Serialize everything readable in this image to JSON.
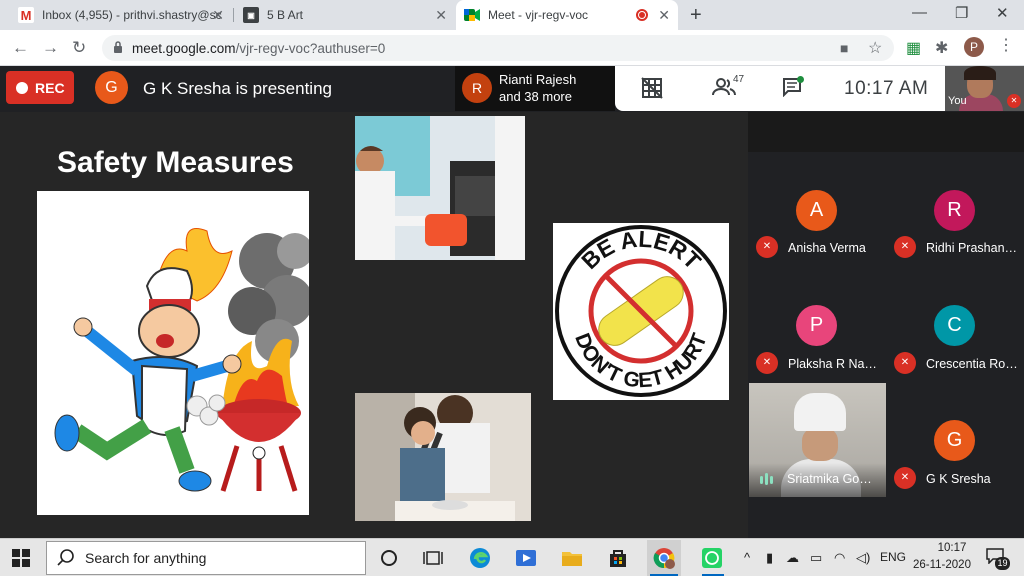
{
  "browser": {
    "tabs": [
      {
        "title": "Inbox (4,955) - prithvi.shastry@sc",
        "icon": "gmail-icon"
      },
      {
        "title": "5 B Art",
        "icon": "classroom-icon"
      },
      {
        "title": "Meet - vjr-regv-voc",
        "icon": "meet-icon",
        "active": true
      }
    ],
    "url_host": "meet.google.com",
    "url_path": "/vjr-regv-voc?authuser=0",
    "profile_initial": "P"
  },
  "meet": {
    "rec_label": "REC",
    "presenter_initial": "G",
    "presenter_text": "G K Sresha is presenting",
    "others_initial": "R",
    "others_line1": "Rianti Rajesh",
    "others_line2": "and 38 more",
    "participant_count": "47",
    "time": "10:17  AM",
    "self_label": "You"
  },
  "slide": {
    "title": "Safety Measures",
    "badge_top": "BE ALERT",
    "badge_bottom": "DON'T GET HURT"
  },
  "participants": [
    {
      "initial": "A",
      "name": "Anisha Verma",
      "color": "#e8591a"
    },
    {
      "initial": "R",
      "name": "Ridhi Prashan…",
      "color": "#c2185b"
    },
    {
      "initial": "P",
      "name": "Plaksha R Na…",
      "color": "#e8457b"
    },
    {
      "initial": "C",
      "name": "Crescentia Ro…",
      "color": "#0097a7"
    },
    {
      "initial": "G",
      "name": "G K Sresha",
      "color": "#e8591a"
    }
  ],
  "video_participant": {
    "name": "Sriatmika Go…"
  },
  "taskbar": {
    "search_placeholder": "Search for anything",
    "lang": "ENG",
    "time": "10:17",
    "date": "26-11-2020",
    "notif_count": "19"
  }
}
